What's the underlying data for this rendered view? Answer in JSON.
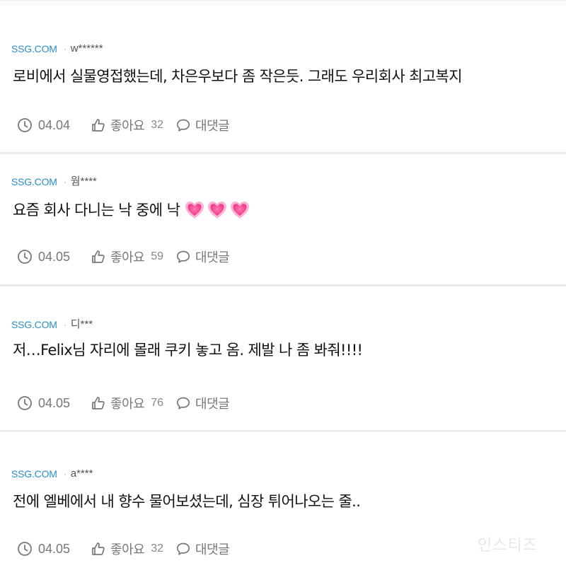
{
  "comments": [
    {
      "source": "SSG.COM",
      "author": "w******",
      "text": "로비에서 실물영접했는데, 차은우보다 좀 작은듯. 그래도 우리회사 최고복지",
      "date": "04.04",
      "like_label": "좋아요",
      "likes": "32",
      "reply_label": "대댓글",
      "hearts": 0
    },
    {
      "source": "SSG.COM",
      "author": "웜****",
      "text": "요즘 회사 다니는 낙 중에 낙",
      "date": "04.05",
      "like_label": "좋아요",
      "likes": "59",
      "reply_label": "대댓글",
      "hearts": 3
    },
    {
      "source": "SSG.COM",
      "author": "디***",
      "text": "저…Felix님 자리에 몰래 쿠키 놓고 옴. 제발 나 좀 봐줘!!!!",
      "date": "04.05",
      "like_label": "좋아요",
      "likes": "76",
      "reply_label": "대댓글",
      "hearts": 0
    },
    {
      "source": "SSG.COM",
      "author": "a****",
      "text": "전에 엘베에서 내 향수 물어보셨는데, 심장 튀어나오는 줄..",
      "date": "04.05",
      "like_label": "좋아요",
      "likes": "32",
      "reply_label": "대댓글",
      "hearts": 0
    }
  ],
  "icons": {
    "clock": "clock-icon",
    "like": "thumbs-up-icon",
    "reply": "speech-bubble-icon",
    "heart": "pink-heart-emoji"
  },
  "colors": {
    "source": "#2a8fc7",
    "meta_gray": "#777777",
    "heart": "#f0509a",
    "divider": "#ebebeb"
  },
  "watermark": "인스티즈"
}
